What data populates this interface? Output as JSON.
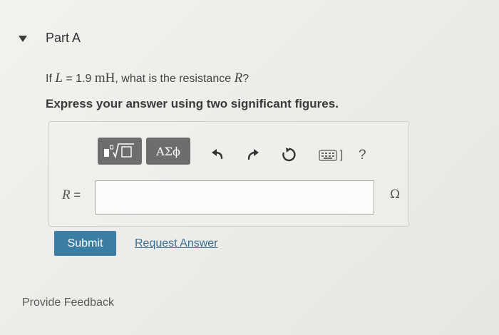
{
  "part": {
    "title": "Part A"
  },
  "question": {
    "prefix": "If",
    "variable": "L",
    "equals": "=",
    "value": "1.9",
    "unit": "mH",
    "middle": ", what is the resistance",
    "target_variable": "R",
    "suffix": "?"
  },
  "instructions": "Express your answer using two significant figures.",
  "toolbar": {
    "templates_icon": "templates-sqrt-icon",
    "symbols_label": "ΑΣϕ",
    "undo_icon": "undo-icon",
    "redo_icon": "redo-icon",
    "reset_icon": "reset-icon",
    "keyboard_icon": "keyboard-icon",
    "keyboard_suffix": "]",
    "help_label": "?"
  },
  "answer": {
    "variable": "R",
    "equals": "=",
    "value": "",
    "unit": "Ω"
  },
  "actions": {
    "submit_label": "Submit",
    "request_answer_label": "Request Answer"
  },
  "feedback": {
    "label": "Provide Feedback"
  },
  "colors": {
    "submit_bg": "#3c7ea3",
    "toolbar_button_bg": "#6d6d6d",
    "link": "#3a6f94"
  }
}
